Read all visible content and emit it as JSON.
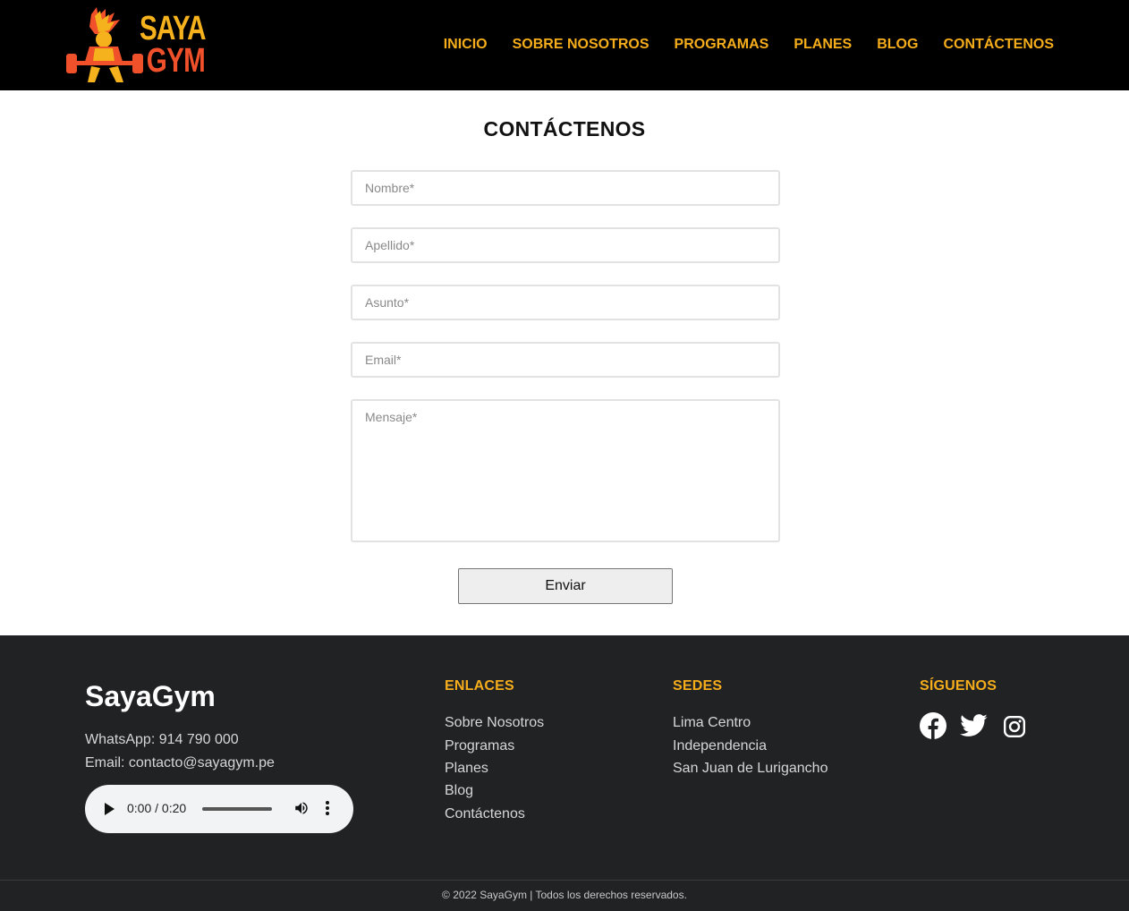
{
  "header": {
    "logo": {
      "line1": "SAYA",
      "line2": "GYM",
      "icon": "weightlifter-logo-icon"
    },
    "nav": [
      "INICIO",
      "SOBRE NOSOTROS",
      "PROGRAMAS",
      "PLANES",
      "BLOG",
      "CONTÁCTENOS"
    ]
  },
  "main": {
    "title": "CONTÁCTENOS",
    "form": {
      "name_placeholder": "Nombre*",
      "lastname_placeholder": "Apellido*",
      "subject_placeholder": "Asunto*",
      "email_placeholder": "Email*",
      "message_placeholder": "Mensaje*",
      "submit_label": "Enviar"
    }
  },
  "footer": {
    "brand": "SayaGym",
    "whatsapp": "WhatsApp: 914 790 000",
    "email": "Email: contacto@sayagym.pe",
    "audio": {
      "time": "0:00 / 0:20",
      "play_icon": "play-icon",
      "volume_icon": "volume-icon",
      "more_icon": "more-vertical-icon"
    },
    "links_title": "ENLACES",
    "links": [
      "Sobre Nosotros",
      "Programas",
      "Planes",
      "Blog",
      "Contáctenos"
    ],
    "locations_title": "SEDES",
    "locations": [
      "Lima Centro",
      "Independencia",
      "San Juan de Lurigancho"
    ],
    "social_title": "SÍGUENOS",
    "social_icons": [
      "facebook-icon",
      "twitter-icon",
      "instagram-icon"
    ],
    "copyright": "© 2022 SayaGym | Todos los derechos reservados."
  },
  "colors": {
    "accent": "#f6ad1b",
    "header_bg": "#000000",
    "footer_bg": "#212224",
    "logo_red": "#f0502a"
  }
}
